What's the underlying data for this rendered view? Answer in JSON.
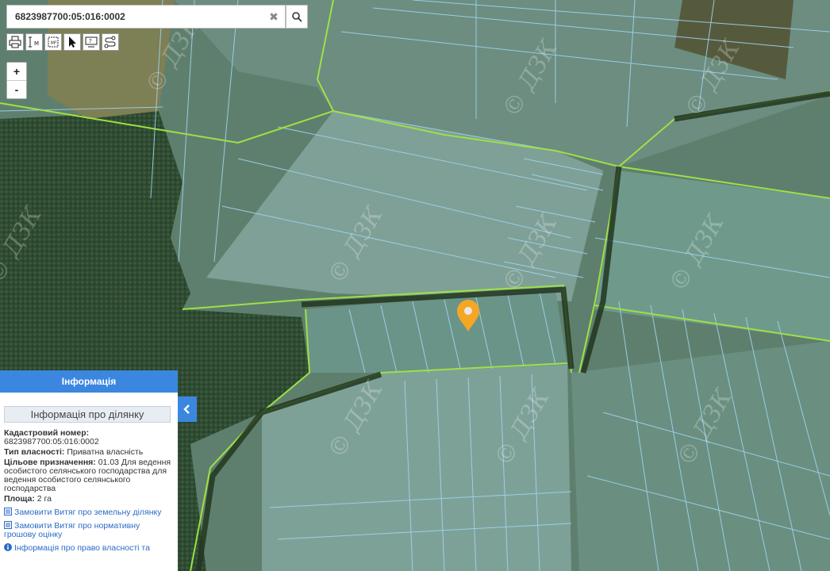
{
  "search": {
    "value": "6823987700:05:016:0002"
  },
  "map": {
    "watermark": "© ДЗК",
    "marker_color": "#f5a623",
    "parcel_line_color": "#9fd4f0",
    "road_line_color": "#9ee047"
  },
  "toolbar": {
    "tools": [
      "printer-icon",
      "ruler-icon",
      "area-measure-icon",
      "pointer-icon",
      "info-icon",
      "route-icon"
    ]
  },
  "zoom": {
    "in_label": "+",
    "out_label": "-"
  },
  "panel": {
    "header": "Інформація",
    "subtitle": "Інформація про ділянку",
    "cadastral_label": "Кадастровий номер:",
    "cadastral_value": "6823987700:05:016:0002",
    "ownership_label": "Тип власності:",
    "ownership_value": "Приватна власність",
    "purpose_label": "Цільове призначення:",
    "purpose_value": "01.03 Для ведення особистого селянського господарства для ведення особистого селянського господарства",
    "area_label": "Площа:",
    "area_value": "2 га",
    "link1": "Замовити Витяг про земельну ділянку",
    "link2": "Замовити Витяг про нормативну грошову оцінку",
    "link3": "Інформація про право власності та"
  }
}
